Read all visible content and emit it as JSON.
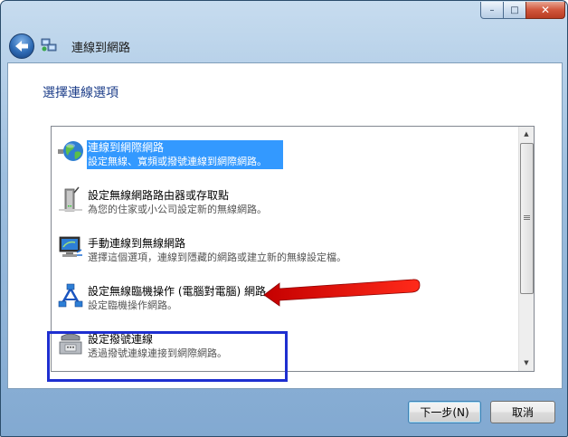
{
  "window": {
    "title_bar": {
      "controls": {
        "minimize": "–",
        "maximize": "□",
        "close": "✕"
      }
    },
    "nav": {
      "back_icon": "back-arrow-icon",
      "title": "連線到網路"
    }
  },
  "content": {
    "heading": "選擇連線選項",
    "options": [
      {
        "icon": "internet-globe-icon",
        "title": "連線到網際網路",
        "desc": "設定無線、寬頻或撥號連線到網際網路。",
        "selected": true
      },
      {
        "icon": "wireless-router-icon",
        "title": "設定無線網路路由器或存取點",
        "desc": "為您的住家或小公司設定新的無線網路。",
        "selected": false
      },
      {
        "icon": "wireless-manual-icon",
        "title": "手動連線到無線網路",
        "desc": "選擇這個選項，連線到隱藏的網路或建立新的無線設定檔。",
        "selected": false
      },
      {
        "icon": "adhoc-network-icon",
        "title": "設定無線臨機操作 (電腦對電腦) 網路",
        "desc": "設定臨機操作網路。",
        "selected": false
      },
      {
        "icon": "dialup-phone-icon",
        "title": "設定撥號連線",
        "desc": "透過撥號連線連接到網際網路。",
        "selected": false
      }
    ],
    "annotation": {
      "box_color": "#1e2fd0",
      "arrow_color": "#e60000"
    }
  },
  "footer": {
    "next_label": "下一步(N)",
    "cancel_label": "取消"
  },
  "colors": {
    "selection": "#3399ff",
    "heading": "#1e3f8a"
  }
}
